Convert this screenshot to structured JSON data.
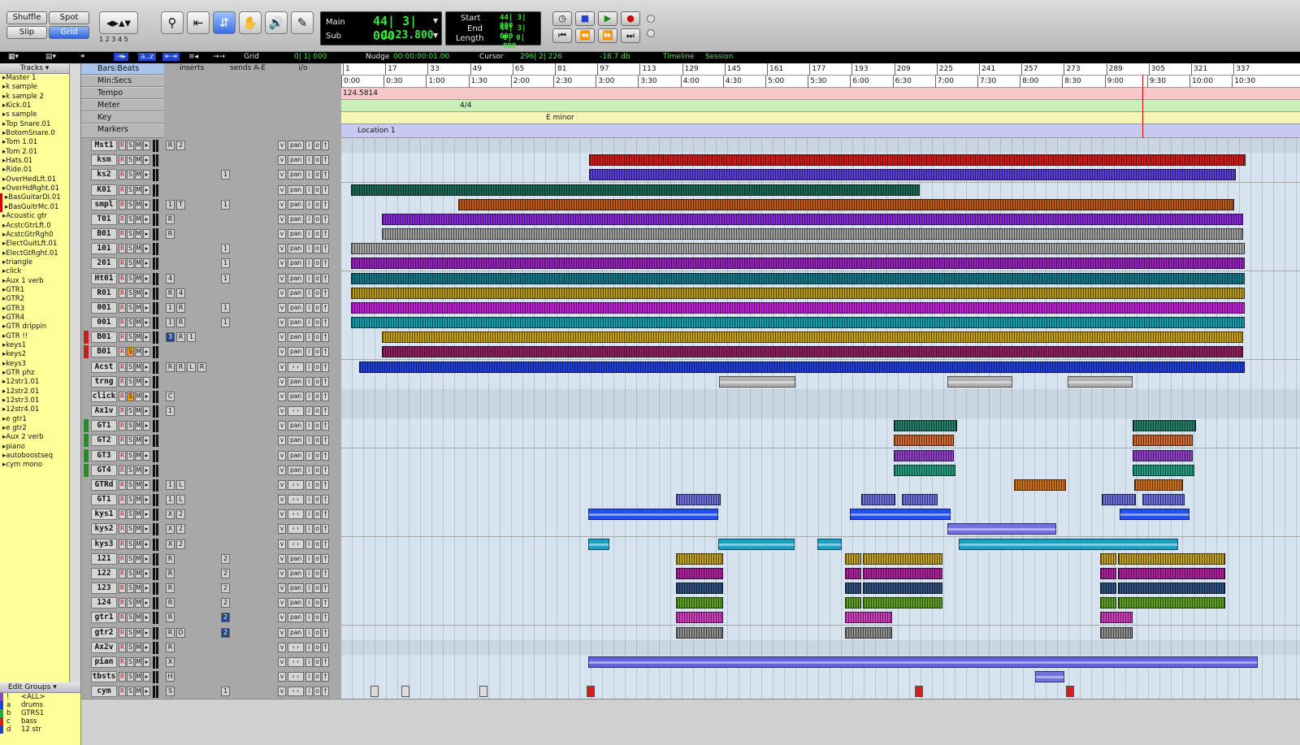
{
  "toolbar": {
    "modes": [
      "Shuffle",
      "Spot",
      "Slip",
      "Grid"
    ],
    "zoom_presets": [
      "1",
      "2",
      "3",
      "4",
      "5"
    ],
    "counter": {
      "main_label": "Main",
      "main_value": "44| 3| 000",
      "sub_label": "Sub",
      "sub_value": "1:23.800",
      "start_label": "Start",
      "start_value": "44| 3| 000",
      "end_label": "End",
      "end_value": "44| 3| 000",
      "length_label": "Length",
      "length_value": "0| 0| 000"
    }
  },
  "statusbar": {
    "grid_label": "Grid",
    "grid_value": "0| 1| 000",
    "nudge_label": "Nudge",
    "nudge_value": "00:00:00:01.00",
    "cursor_label": "Cursor",
    "cursor_value": "296| 2| 226",
    "db_value": "-18.7 db",
    "timeline_label": "Timeline",
    "session_label": "Session",
    "sort_label": "a..z"
  },
  "tracks_panel": {
    "title": "Tracks",
    "items": [
      "Master 1",
      "k sample",
      "k sample 2",
      "Kick.01",
      "s sample",
      "Top Snare.01",
      "BotomSnare.0",
      "Tom 1.01",
      "Tom 2.01",
      "Hats.01",
      "Ride.01",
      "OverHedLft.01",
      "OverHdRght.01",
      "BasGuitarDI.01",
      "BasGuitrMc.01",
      "Acoustic gtr",
      "AcstcGtrLft.0",
      "AcstcGtrRgh0",
      "ElectGuitLft.01",
      "ElectGtRght.01",
      "triangle",
      "click",
      "Aux 1 verb",
      "GTR1",
      "GTR2",
      "GTR3",
      "GTR4",
      "GTR drippin",
      "GTR !!",
      "keys1",
      "keys2",
      "keys3",
      "GTR phz",
      "12str1.01",
      "12str2.01",
      "12str3.01",
      "12str4.01",
      "e gtr1",
      "e gtr2",
      "Aux 2 verb",
      "piano",
      "autoboostseq",
      "cym mono"
    ]
  },
  "groups_panel": {
    "title": "Edit Groups",
    "groups": [
      {
        "id": "! ",
        "name": "<ALL>"
      },
      {
        "id": "a",
        "name": "drums"
      },
      {
        "id": "b",
        "name": "GTRS1"
      },
      {
        "id": "c",
        "name": "bass"
      },
      {
        "id": "d",
        "name": "12 str"
      }
    ]
  },
  "column_headers": {
    "inserts": "inserts",
    "sends": "sends A-E",
    "io": "i/o"
  },
  "rulers": {
    "labels": [
      "Bars:Beats",
      "Min:Secs",
      "Tempo",
      "Meter",
      "Key",
      "Markers"
    ],
    "bars": [
      "1",
      "17",
      "33",
      "49",
      "65",
      "81",
      "97",
      "113",
      "129",
      "145",
      "161",
      "177",
      "193",
      "209",
      "225",
      "241",
      "257",
      "273",
      "289",
      "305",
      "321",
      "337"
    ],
    "times": [
      "0:00",
      "0:30",
      "1:00",
      "1:30",
      "2:00",
      "2:30",
      "3:00",
      "3:30",
      "4:00",
      "4:30",
      "5:00",
      "5:30",
      "6:00",
      "6:30",
      "7:00",
      "7:30",
      "8:00",
      "8:30",
      "9:00",
      "9:30",
      "10:00",
      "10:30"
    ],
    "tempo": "124.5814",
    "meter": "4/4",
    "key": "E minor",
    "marker": "Location 1"
  },
  "tracks": [
    {
      "name": "Mst1",
      "ins": [
        "R",
        "2"
      ],
      "send": "",
      "io": "m"
    },
    {
      "name": "ksm",
      "ins": [],
      "send": "",
      "io": "a"
    },
    {
      "name": "ks2",
      "ins": [],
      "send": "1",
      "io": "a"
    },
    {
      "name": "K01",
      "ins": [],
      "send": "",
      "io": "a"
    },
    {
      "name": "smpl",
      "ins": [
        "1",
        "T"
      ],
      "send": "1",
      "io": "a"
    },
    {
      "name": "T01",
      "ins": [
        "R"
      ],
      "send": "",
      "io": "a"
    },
    {
      "name": "B01",
      "ins": [
        "R"
      ],
      "send": "",
      "io": "a"
    },
    {
      "name": "101",
      "ins": [],
      "send": "1",
      "io": "a"
    },
    {
      "name": "201",
      "ins": [],
      "send": "1",
      "io": "a"
    },
    {
      "name": "Ht01",
      "ins": [
        "4"
      ],
      "send": "1",
      "io": "a"
    },
    {
      "name": "R01",
      "ins": [
        "R",
        "4"
      ],
      "send": "",
      "io": "a"
    },
    {
      "name": "001",
      "ins": [
        "1",
        "R"
      ],
      "send": "1",
      "io": "a"
    },
    {
      "name": "001",
      "ins": [
        "1",
        "R"
      ],
      "send": "1",
      "io": "a"
    },
    {
      "name": "B01",
      "ins": [
        "3",
        "R",
        "1"
      ],
      "send": "",
      "io": "a"
    },
    {
      "name": "B01",
      "ins": [],
      "send": "",
      "io": "a"
    },
    {
      "name": "Acst",
      "ins": [
        "R",
        "R",
        "L",
        "R"
      ],
      "send": "",
      "io": "s"
    },
    {
      "name": "trng",
      "ins": [],
      "send": "",
      "io": "a"
    },
    {
      "name": "click",
      "ins": [
        "C"
      ],
      "send": "",
      "io": "m"
    },
    {
      "name": "Ax1v",
      "ins": [
        "1"
      ],
      "send": "",
      "io": "s"
    },
    {
      "name": "GT1",
      "ins": [],
      "send": "",
      "io": "a"
    },
    {
      "name": "GT2",
      "ins": [],
      "send": "",
      "io": "a"
    },
    {
      "name": "GT3",
      "ins": [],
      "send": "",
      "io": "a"
    },
    {
      "name": "GT4",
      "ins": [],
      "send": "",
      "io": "a"
    },
    {
      "name": "GTRd",
      "ins": [
        "1",
        "L"
      ],
      "send": "",
      "io": "s"
    },
    {
      "name": "GT1",
      "ins": [
        "1",
        "L"
      ],
      "send": "",
      "io": "s"
    },
    {
      "name": "kys1",
      "ins": [
        "X",
        "2"
      ],
      "send": "",
      "io": "s"
    },
    {
      "name": "kys2",
      "ins": [
        "X",
        "2"
      ],
      "send": "",
      "io": "s"
    },
    {
      "name": "kys3",
      "ins": [
        "X",
        "2"
      ],
      "send": "",
      "io": "s"
    },
    {
      "name": "121",
      "ins": [
        "R"
      ],
      "send": "2",
      "io": "a"
    },
    {
      "name": "122",
      "ins": [
        "R"
      ],
      "send": "2",
      "io": "a"
    },
    {
      "name": "123",
      "ins": [
        "R"
      ],
      "send": "2",
      "io": "a"
    },
    {
      "name": "124",
      "ins": [
        "R"
      ],
      "send": "2",
      "io": "a"
    },
    {
      "name": "gtr1",
      "ins": [
        "R"
      ],
      "send": "2",
      "io": "a"
    },
    {
      "name": "gtr2",
      "ins": [
        "R",
        "D"
      ],
      "send": "2",
      "io": "a"
    },
    {
      "name": "Ax2v",
      "ins": [
        "R"
      ],
      "send": "",
      "io": "s"
    },
    {
      "name": "pian",
      "ins": [
        "X"
      ],
      "send": "",
      "io": "s"
    },
    {
      "name": "tbsts",
      "ins": [
        "H"
      ],
      "send": "",
      "io": "s"
    },
    {
      "name": "cym",
      "ins": [
        "S"
      ],
      "send": "1",
      "io": "s"
    }
  ],
  "io_labels": {
    "vol": "v",
    "pan": "pan",
    "stereo": "‹ › ",
    "in": "i",
    "out": "o",
    "rec": "†"
  },
  "colors": {
    "accent": "#2d64d8",
    "counter_green": "#39e639",
    "tempo_row": "#f8c8c8",
    "meter_row": "#c8f0b8",
    "key_row": "#f6f6b0",
    "marker_row": "#c8c8f0"
  }
}
